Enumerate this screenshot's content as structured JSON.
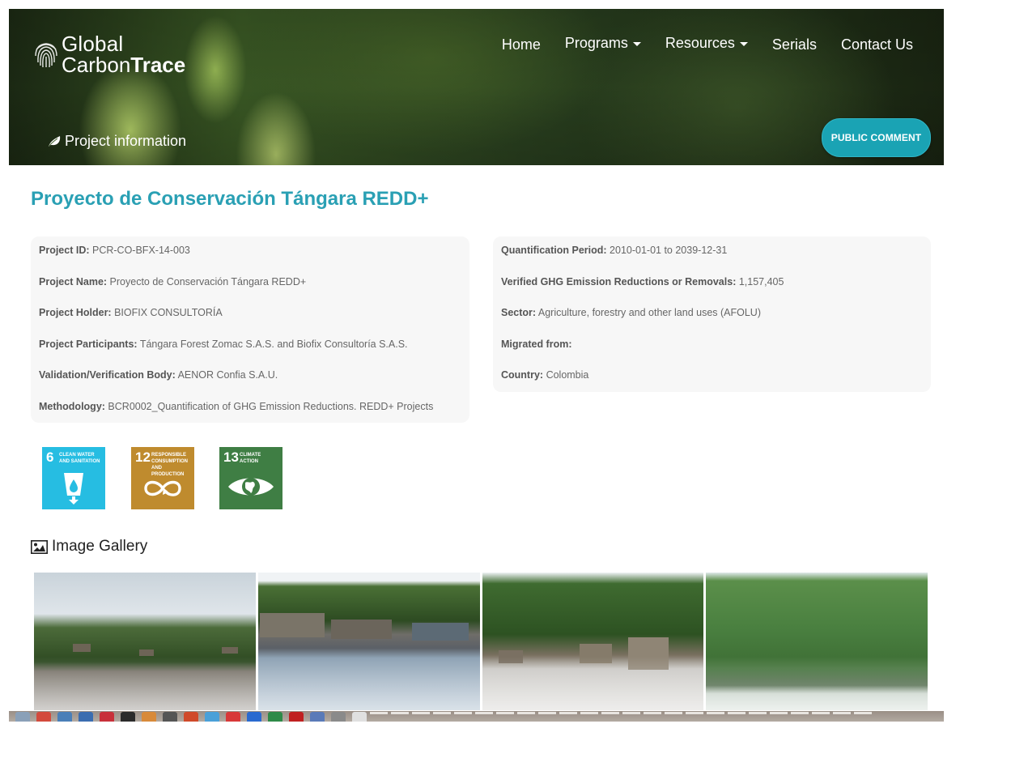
{
  "header": {
    "logo": {
      "line1": "Global",
      "line2_a": "Carbon",
      "line2_b": "Trace"
    },
    "nav": [
      {
        "label": "Home",
        "dropdown": false
      },
      {
        "label": "Programs",
        "dropdown": true
      },
      {
        "label": "Resources",
        "dropdown": true
      },
      {
        "label": "Serials",
        "dropdown": false
      },
      {
        "label": "Contact Us",
        "dropdown": false
      }
    ],
    "section_label": "Project information",
    "public_comment_label": "PUBLIC COMMENT"
  },
  "project": {
    "title": "Proyecto de Conservación Tángara REDD+",
    "left": [
      {
        "label": "Project ID:",
        "value": "PCR-CO-BFX-14-003"
      },
      {
        "label": "Project Name:",
        "value": "Proyecto de Conservación Tángara REDD+"
      },
      {
        "label": "Project Holder:",
        "value": "BIOFIX CONSULTORÍA"
      },
      {
        "label": "Project Participants:",
        "value": "Tángara Forest Zomac S.A.S. and Biofix Consultoría S.A.S."
      },
      {
        "label": "Validation/Verification Body:",
        "value": "AENOR Confia S.A.U."
      },
      {
        "label": "Methodology:",
        "value": "BCR0002_Quantification of GHG Emission Reductions. REDD+ Projects"
      }
    ],
    "right": [
      {
        "label": "Quantification Period:",
        "value": "2010-01-01 to 2039-12-31"
      },
      {
        "label": "Verified GHG Emission Reductions or Removals:",
        "value": "1,157,405"
      },
      {
        "label": "Sector:",
        "value": "Agriculture, forestry and other land uses (AFOLU)"
      },
      {
        "label": "Migrated from:",
        "value": ""
      },
      {
        "label": "Country:",
        "value": "Colombia"
      }
    ]
  },
  "sdgs": [
    {
      "number": "6",
      "caption": "CLEAN WATER AND SANITATION",
      "icon": "water-drop-icon",
      "color": "#26bde2"
    },
    {
      "number": "12",
      "caption": "RESPONSIBLE CONSUMPTION AND PRODUCTION",
      "icon": "infinity-icon",
      "color": "#bf8b2e"
    },
    {
      "number": "13",
      "caption": "CLIMATE ACTION",
      "icon": "eye-globe-icon",
      "color": "#3f7e44"
    }
  ],
  "gallery": {
    "title": "Image Gallery",
    "icon": "picture-icon",
    "images": [
      "gallery-photo-1",
      "gallery-photo-2",
      "gallery-photo-3",
      "gallery-photo-4"
    ]
  },
  "colors": {
    "accent": "#2aa0b4",
    "button": "#1aa3b4"
  }
}
